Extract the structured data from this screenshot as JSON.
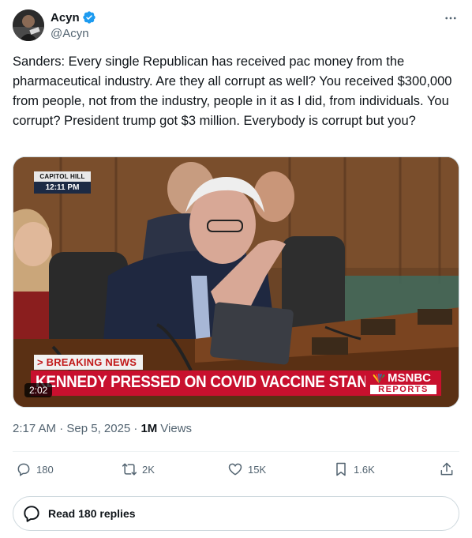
{
  "author": {
    "display_name": "Acyn",
    "handle": "@Acyn",
    "verified": true
  },
  "tweet": {
    "text": "Sanders: Every single Republican has received pac money from the pharmaceutical industry. Are they all corrupt as well? You received $300,000 from people, not from the industry, people in it as I did, from individuals. You corrupt? President trump got $3 million. Everybody is corrupt but you?"
  },
  "video": {
    "location": "CAPITOL HILL",
    "time": "12:11 PM",
    "breaking": "> BREAKING NEWS",
    "headline": "KENNEDY PRESSED ON COVID VACCINE STANCE",
    "network": "MSNBC",
    "program": "REPORTS",
    "duration": "2:02"
  },
  "meta": {
    "timestamp": "2:17 AM · Sep 5, 2025 ·",
    "views_count": "1M",
    "views_label": "Views"
  },
  "actions": {
    "replies": "180",
    "reposts": "2K",
    "likes": "15K",
    "bookmarks": "1.6K"
  },
  "read_replies": "Read 180 replies",
  "colors": {
    "verified": "#1d9bf0",
    "text_primary": "#0f1419",
    "text_secondary": "#536471",
    "chyron_red": "#c8102e"
  },
  "icons": [
    "verified-badge-icon",
    "more-icon",
    "reply-icon",
    "repost-icon",
    "like-icon",
    "bookmark-icon",
    "share-icon",
    "speech-bubble-icon"
  ]
}
